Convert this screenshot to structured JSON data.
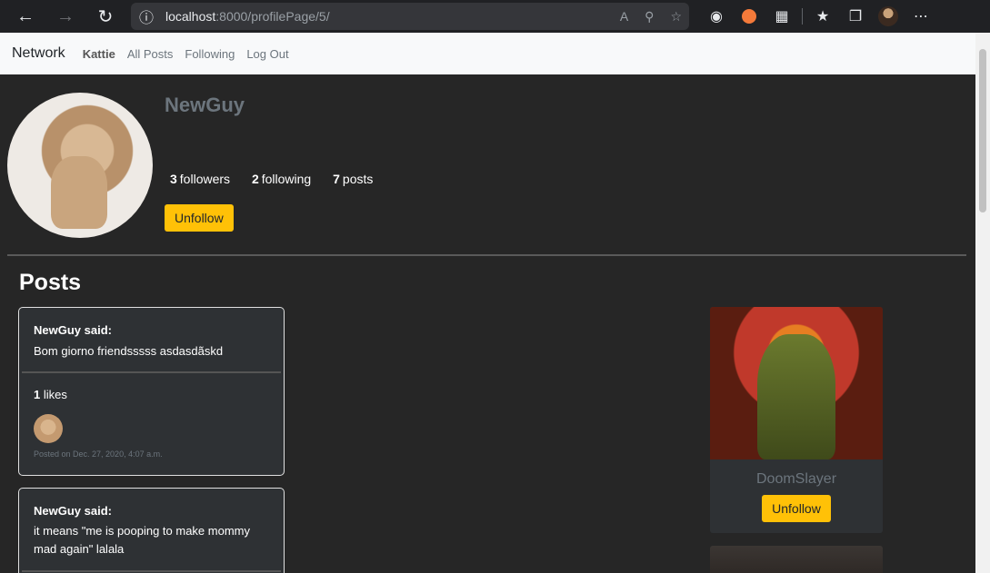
{
  "browser": {
    "url_host": "localhost",
    "url_path": ":8000/profilePage/5/"
  },
  "navbar": {
    "brand": "Network",
    "username": "Kattie",
    "links": [
      "All Posts",
      "Following",
      "Log Out"
    ]
  },
  "profile": {
    "name": "NewGuy",
    "followers_count": "3",
    "followers_label": "followers",
    "following_count": "2",
    "following_label": "following",
    "posts_count": "7",
    "posts_label": "posts",
    "button": "Unfollow"
  },
  "posts_title": "Posts",
  "posts": [
    {
      "author": "NewGuy said:",
      "content": "Bom giorno friendsssss asdasdãskd",
      "likes_count": "1",
      "likes_label": "likes",
      "date": "Posted on Dec. 27, 2020, 4:07 a.m."
    },
    {
      "author": "NewGuy said:",
      "content": "it means \"me is pooping to make mommy mad again\" lalala"
    }
  ],
  "following_cards": [
    {
      "name": "DoomSlayer",
      "button": "Unfollow"
    }
  ],
  "colors": {
    "accent": "#ffc107",
    "page_bg": "#262626",
    "card_bg": "#2e3134"
  }
}
